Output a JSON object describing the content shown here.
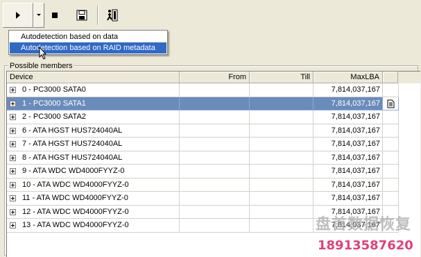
{
  "toolbar": {
    "buttons": [
      {
        "name": "play-icon"
      },
      {
        "name": "dropdown-arrow-icon"
      },
      {
        "name": "stop-icon"
      },
      {
        "name": "save-icon"
      },
      {
        "name": "exit-icon"
      }
    ]
  },
  "menu": {
    "items": [
      {
        "label": "Autodetection based on data",
        "selected": false
      },
      {
        "label": "Autodetection based on RAID metadata",
        "selected": true
      }
    ]
  },
  "group": {
    "title": "Possible members"
  },
  "grid": {
    "columns": [
      "Device",
      "From",
      "Till",
      "MaxLBA"
    ],
    "rows": [
      {
        "device": "0 - PC3000 SATA0",
        "from": "",
        "till": "",
        "maxlba": "7,814,037,167",
        "selected": false
      },
      {
        "device": "1 - PC3000 SATA1",
        "from": "",
        "till": "",
        "maxlba": "7,814,037,167",
        "selected": true
      },
      {
        "device": "2 - PC3000 SATA2",
        "from": "",
        "till": "",
        "maxlba": "7,814,037,167",
        "selected": false
      },
      {
        "device": "6 - ATA HGST HUS724040AL",
        "from": "",
        "till": "",
        "maxlba": "7,814,037,167",
        "selected": false
      },
      {
        "device": "7 - ATA HGST HUS724040AL",
        "from": "",
        "till": "",
        "maxlba": "7,814,037,167",
        "selected": false
      },
      {
        "device": "8 - ATA HGST HUS724040AL",
        "from": "",
        "till": "",
        "maxlba": "7,814,037,167",
        "selected": false
      },
      {
        "device": "9 - ATA WDC WD4000FYYZ-0",
        "from": "",
        "till": "",
        "maxlba": "7,814,037,167",
        "selected": false
      },
      {
        "device": "10 - ATA WDC WD4000FYYZ-0",
        "from": "",
        "till": "",
        "maxlba": "7,814,037,167",
        "selected": false
      },
      {
        "device": "11 - ATA WDC WD4000FYYZ-0",
        "from": "",
        "till": "",
        "maxlba": "7,814,037,167",
        "selected": false
      },
      {
        "device": "12 - ATA WDC WD4000FYYZ-0",
        "from": "",
        "till": "",
        "maxlba": "7,814,037,167",
        "selected": false
      },
      {
        "device": "13 - ATA WDC WD4000FYYZ-0",
        "from": "",
        "till": "",
        "maxlba": "7,814,037,167",
        "selected": false
      }
    ]
  },
  "watermark": {
    "text": "盘首数据恢复",
    "phone": "18913587620"
  },
  "colors": {
    "selection": "#316AC5",
    "row_selected": "#6A8CBC",
    "window_bg": "#ECE9D8",
    "watermark_phone": "#E0407C"
  }
}
